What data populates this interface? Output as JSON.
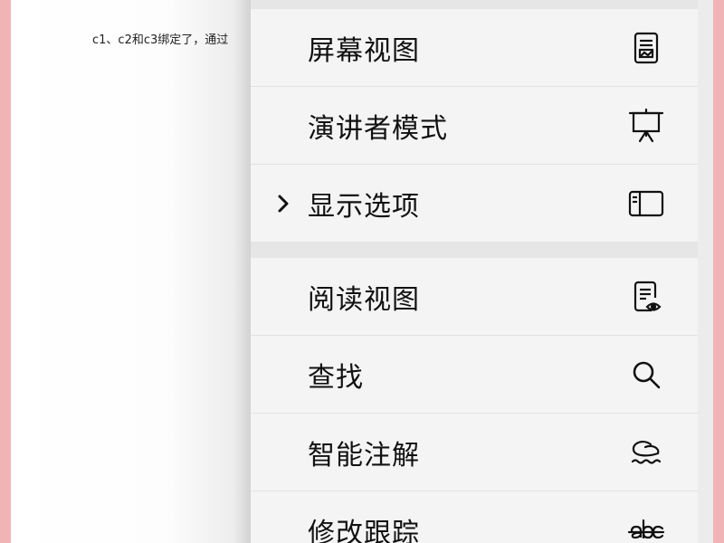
{
  "document": {
    "text_line": "c1、c2和c3绑定了，通过"
  },
  "menu": {
    "group1": [
      {
        "label": "屏幕视图",
        "icon": "screen-view-icon",
        "has_chevron": false
      },
      {
        "label": "演讲者模式",
        "icon": "presenter-easel-icon",
        "has_chevron": false
      },
      {
        "label": "显示选项",
        "icon": "display-panel-icon",
        "has_chevron": true
      }
    ],
    "group2": [
      {
        "label": "阅读视图",
        "icon": "reading-view-icon",
        "has_chevron": false
      },
      {
        "label": "查找",
        "icon": "search-icon",
        "has_chevron": false
      },
      {
        "label": "智能注解",
        "icon": "smart-annotation-icon",
        "has_chevron": false
      },
      {
        "label": "修改跟踪",
        "icon": "track-changes-icon",
        "has_chevron": false
      }
    ],
    "colors": {
      "item_bg": "#f4f4f4",
      "separator_bg": "#e6e6e6",
      "text": "#111111",
      "page_border": "#f1b4b6"
    }
  }
}
